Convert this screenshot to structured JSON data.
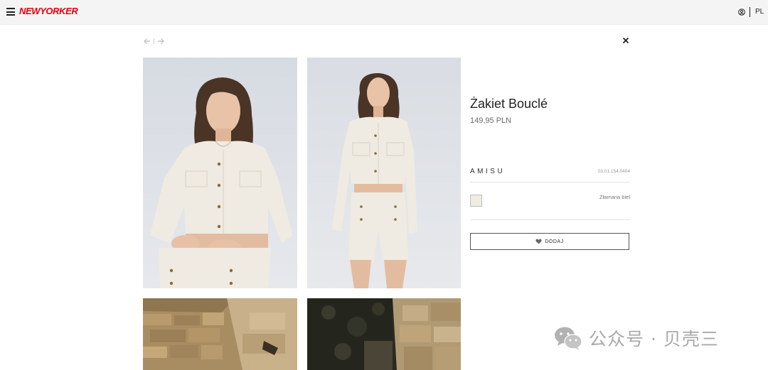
{
  "header": {
    "logo_text": "NEWYORKER",
    "language": "PL",
    "icons": [
      "menu-icon",
      "account-icon"
    ]
  },
  "navigation": {
    "prev_icon": "arrow-left-icon",
    "next_icon": "arrow-right-icon",
    "close_icon": "close-icon"
  },
  "gallery": {
    "images": [
      "model-jacket-front",
      "model-jacket-shorts-full",
      "stone-wall",
      "stone-wall-dark"
    ]
  },
  "product": {
    "title": "Żakiet Bouclé",
    "price": "149,95 PLN",
    "brand": "AMISU",
    "sku": "03.01.154.0404",
    "color_name": "Złamana biel",
    "color_hex": "#efece4",
    "add_button_label": "DODAJ",
    "add_button_icon": "heart-icon"
  },
  "watermark": {
    "text": "公众号 · 贝壳三",
    "icon": "wechat-icon"
  },
  "colors": {
    "brand_red": "#e1000f",
    "topbar_bg": "#f4f4f4",
    "text_dark": "#222222"
  }
}
